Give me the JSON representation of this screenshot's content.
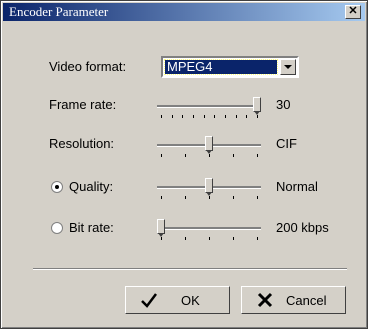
{
  "window": {
    "title": "Encoder Parameter",
    "close_icon": "close-icon"
  },
  "video_format": {
    "label": "Video format:",
    "selected": "MPEG4"
  },
  "frame_rate": {
    "label": "Frame rate:",
    "value": "30",
    "level": 1.0
  },
  "resolution": {
    "label": "Resolution:",
    "value": "CIF",
    "level": 0.5
  },
  "quality": {
    "label": "Quality:",
    "value": "Normal",
    "level": 0.5,
    "selected": true
  },
  "bit_rate": {
    "label": "Bit rate:",
    "value": "200 kbps",
    "level": 0.0,
    "selected": false
  },
  "buttons": {
    "ok": "OK",
    "cancel": "Cancel"
  }
}
